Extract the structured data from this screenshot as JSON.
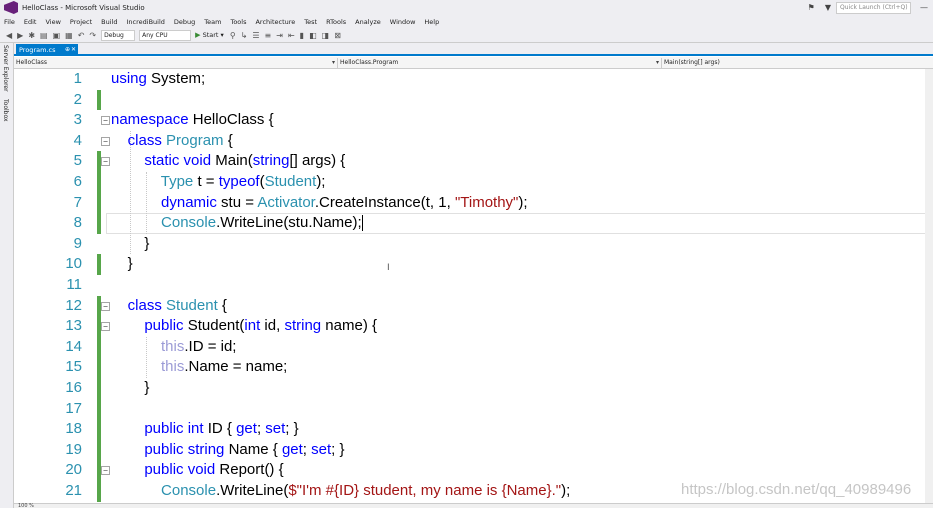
{
  "window": {
    "title": "HelloClass - Microsoft Visual Studio",
    "quick_launch_placeholder": "Quick Launch (Ctrl+Q)",
    "minimize_glyph": "▼",
    "restore_glyph": "—",
    "close_glyph": "✕"
  },
  "menu": [
    "File",
    "Edit",
    "View",
    "Project",
    "Build",
    "IncrediBuild",
    "Debug",
    "Team",
    "Tools",
    "Architecture",
    "Test",
    "RTools",
    "Analyze",
    "Window",
    "Help"
  ],
  "toolbar": {
    "config": "Debug",
    "platform": "Any CPU",
    "start_label": "Start",
    "start_glyph": "▶"
  },
  "sidebar": {
    "tabs": [
      "Server Explorer",
      "Toolbox"
    ]
  },
  "document_tab": {
    "label": "Program.cs",
    "pin_glyph": "⊕",
    "close_glyph": "✕"
  },
  "navbar": {
    "project": "HelloClass",
    "type": "HelloClass.Program",
    "member": "Main(string[] args)"
  },
  "status": {
    "zoom": "100 %"
  },
  "watermark": "https://blog.csdn.net/qq_40989496",
  "code_lines": [
    {
      "num": "1",
      "tokens": [
        [
          "kw",
          "using"
        ],
        [
          "plain",
          " System;"
        ]
      ]
    },
    {
      "num": "2",
      "tokens": []
    },
    {
      "num": "3",
      "tokens": [
        [
          "kw",
          "namespace"
        ],
        [
          "plain",
          " HelloClass {"
        ]
      ]
    },
    {
      "num": "4",
      "tokens": [
        [
          "plain",
          "    "
        ],
        [
          "kw",
          "class"
        ],
        [
          "plain",
          " "
        ],
        [
          "type",
          "Program"
        ],
        [
          "plain",
          " {"
        ]
      ]
    },
    {
      "num": "5",
      "tokens": [
        [
          "plain",
          "        "
        ],
        [
          "kw",
          "static"
        ],
        [
          "plain",
          " "
        ],
        [
          "kw",
          "void"
        ],
        [
          "plain",
          " Main("
        ],
        [
          "kw",
          "string"
        ],
        [
          "plain",
          "[] args) {"
        ]
      ]
    },
    {
      "num": "6",
      "tokens": [
        [
          "plain",
          "            "
        ],
        [
          "type",
          "Type"
        ],
        [
          "plain",
          " t = "
        ],
        [
          "kw",
          "typeof"
        ],
        [
          "plain",
          "("
        ],
        [
          "type",
          "Student"
        ],
        [
          "plain",
          ");"
        ]
      ]
    },
    {
      "num": "7",
      "tokens": [
        [
          "plain",
          "            "
        ],
        [
          "kw",
          "dynamic"
        ],
        [
          "plain",
          " stu = "
        ],
        [
          "type",
          "Activator"
        ],
        [
          "plain",
          ".CreateInstance(t, 1, "
        ],
        [
          "str",
          "\"Timothy\""
        ],
        [
          "plain",
          ");"
        ]
      ]
    },
    {
      "num": "8",
      "tokens": [
        [
          "plain",
          "            "
        ],
        [
          "type",
          "Console"
        ],
        [
          "plain",
          ".WriteLine(stu.Name);"
        ]
      ]
    },
    {
      "num": "9",
      "tokens": [
        [
          "plain",
          "        }"
        ]
      ]
    },
    {
      "num": "10",
      "tokens": [
        [
          "plain",
          "    }"
        ]
      ]
    },
    {
      "num": "11",
      "tokens": []
    },
    {
      "num": "12",
      "tokens": [
        [
          "plain",
          "    "
        ],
        [
          "kw",
          "class"
        ],
        [
          "plain",
          " "
        ],
        [
          "type",
          "Student"
        ],
        [
          "plain",
          " {"
        ]
      ]
    },
    {
      "num": "13",
      "tokens": [
        [
          "plain",
          "        "
        ],
        [
          "kw",
          "public"
        ],
        [
          "plain",
          " Student("
        ],
        [
          "kw",
          "int"
        ],
        [
          "plain",
          " id, "
        ],
        [
          "kw",
          "string"
        ],
        [
          "plain",
          " name) {"
        ]
      ]
    },
    {
      "num": "14",
      "tokens": [
        [
          "plain",
          "            "
        ],
        [
          "this",
          "this"
        ],
        [
          "plain",
          ".ID = id;"
        ]
      ]
    },
    {
      "num": "15",
      "tokens": [
        [
          "plain",
          "            "
        ],
        [
          "this",
          "this"
        ],
        [
          "plain",
          ".Name = name;"
        ]
      ]
    },
    {
      "num": "16",
      "tokens": [
        [
          "plain",
          "        }"
        ]
      ]
    },
    {
      "num": "17",
      "tokens": []
    },
    {
      "num": "18",
      "tokens": [
        [
          "plain",
          "        "
        ],
        [
          "kw",
          "public"
        ],
        [
          "plain",
          " "
        ],
        [
          "kw",
          "int"
        ],
        [
          "plain",
          " ID { "
        ],
        [
          "kw",
          "get"
        ],
        [
          "plain",
          "; "
        ],
        [
          "kw",
          "set"
        ],
        [
          "plain",
          "; }"
        ]
      ]
    },
    {
      "num": "19",
      "tokens": [
        [
          "plain",
          "        "
        ],
        [
          "kw",
          "public"
        ],
        [
          "plain",
          " "
        ],
        [
          "kw",
          "string"
        ],
        [
          "plain",
          " Name { "
        ],
        [
          "kw",
          "get"
        ],
        [
          "plain",
          "; "
        ],
        [
          "kw",
          "set"
        ],
        [
          "plain",
          "; }"
        ]
      ]
    },
    {
      "num": "20",
      "tokens": [
        [
          "plain",
          "        "
        ],
        [
          "kw",
          "public"
        ],
        [
          "plain",
          " "
        ],
        [
          "kw",
          "void"
        ],
        [
          "plain",
          " Report() {"
        ]
      ]
    },
    {
      "num": "21",
      "tokens": [
        [
          "plain",
          "            "
        ],
        [
          "type",
          "Console"
        ],
        [
          "plain",
          ".WriteLine("
        ],
        [
          "str",
          "$\"I'm #{ID} student, my name is {Name}.\""
        ],
        [
          "plain",
          ");"
        ]
      ]
    }
  ],
  "colors": {
    "keyword": "#0000ff",
    "type": "#2b91af",
    "string": "#a31515",
    "this": "#9b9bd6",
    "line_number": "#2b91af",
    "change_bar": "#57a64a",
    "accent": "#007acc"
  }
}
